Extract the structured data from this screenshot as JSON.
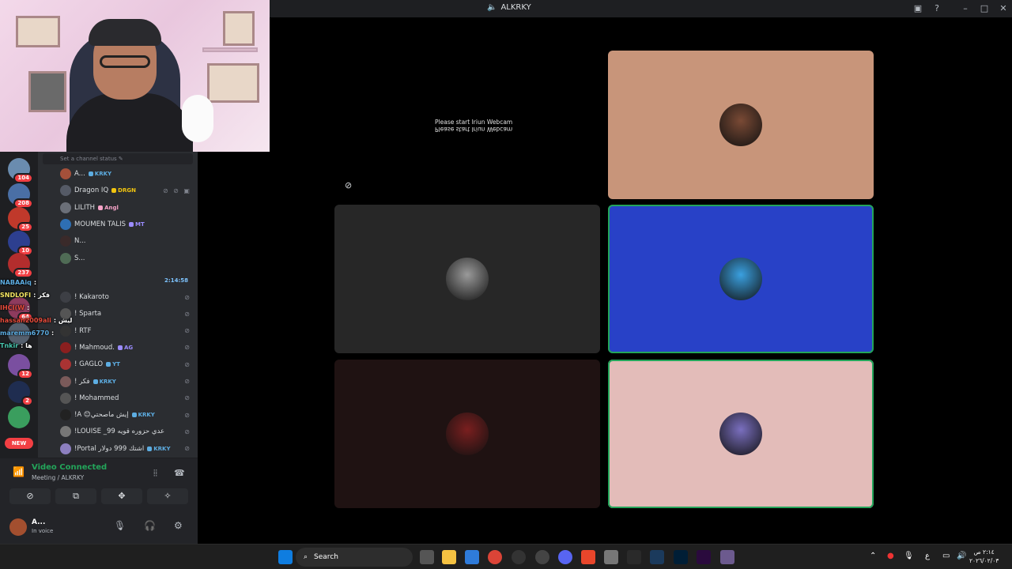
{
  "window": {
    "title": "ALKRKY"
  },
  "channel_status_hint": "Set a channel status",
  "servers": [
    {
      "badge": "104",
      "color": "#6a8caf"
    },
    {
      "badge": "208",
      "color": "#4a6fa5"
    },
    {
      "badge": "25",
      "color": "#c0392b"
    },
    {
      "badge": "10",
      "color": "#2d3f8f"
    },
    {
      "badge": "237",
      "color": "#b32d2d"
    },
    {
      "badge": "64",
      "color": "#8e3b5e"
    },
    {
      "badge": "",
      "color": "#55606e"
    },
    {
      "badge": "12",
      "color": "#7a4fa0"
    },
    {
      "badge": "2",
      "color": "#1f2d50"
    },
    {
      "badge": "",
      "color": "#3a9e5e"
    },
    {
      "badge": "NEW",
      "color": "#f23f43"
    }
  ],
  "members_top": [
    {
      "name": "A...",
      "tag": "KRKY",
      "tag_color": "#5dade2",
      "av": "#a5503a"
    },
    {
      "name": "Dragon IQ",
      "tag": "DRGN",
      "tag_color": "#f1c40f",
      "av": "#555a66",
      "icons": "⊘ ⊘ ▣"
    },
    {
      "name": "LILITH",
      "tag": "Angl",
      "tag_color": "#f5a3c7",
      "av": "#6b6f78"
    },
    {
      "name": "MOUMEN TALIS",
      "tag": "MT",
      "tag_color": "#9b8cff",
      "av": "#2e6fb3"
    },
    {
      "name": "N...",
      "tag": "",
      "tag_color": "#888",
      "av": "#3a2a2a"
    },
    {
      "name": "S...",
      "tag": "",
      "tag_color": "#888",
      "av": "#4f6b55"
    }
  ],
  "members_bottom": [
    {
      "name": "! Kakaroto",
      "tag": "",
      "tag_color": "#5dade2",
      "av": "#3d3f45"
    },
    {
      "name": "! Sparta",
      "tag": "",
      "tag_color": "#bbb",
      "av": "#555"
    },
    {
      "name": "! RTF",
      "tag": "",
      "tag_color": "#bbb",
      "av": "#333"
    },
    {
      "name": "! Mahmoud.",
      "tag": "AG",
      "tag_color": "#9b8cff",
      "av": "#8a1f1f"
    },
    {
      "name": "! GAGLO",
      "tag": "YT",
      "tag_color": "#5dade2",
      "av": "#a33"
    },
    {
      "name": "! فكر",
      "tag": "KRKY",
      "tag_color": "#5dade2",
      "av": "#7a5a5a"
    },
    {
      "name": "! Mohammed",
      "tag": "",
      "tag_color": "#bbb",
      "av": "#555"
    },
    {
      "name": "!A 😊إيش ماصحتي",
      "tag": "KRKY",
      "tag_color": "#5dade2",
      "av": "#222"
    },
    {
      "name": "!LOUISE _99 عدي حزوره قويه",
      "tag": "",
      "tag_color": "#f1c40f",
      "av": "#777"
    },
    {
      "name": "!Portal اشتك 999 دولار",
      "tag": "KRKY",
      "tag_color": "#5dade2",
      "av": "#8c7fbf"
    }
  ],
  "chat": {
    "timestamp": "2:14:58",
    "lines": [
      {
        "user": "NABAAiq",
        "text": ":",
        "color": "#5dade2"
      },
      {
        "user": "SNDLOFI",
        "text": ": فكر",
        "color": "#f5e663"
      },
      {
        "user": "IHCI(W",
        "text": ":",
        "color": "#e74c3c"
      },
      {
        "user": "hassan2009ali",
        "text": ": ليش",
        "color": "#e74c3c"
      },
      {
        "user": "maremm6770",
        "text": ":",
        "color": "#5dade2"
      },
      {
        "user": "Tnkir",
        "text": ": ها",
        "color": "#48c9b0"
      }
    ]
  },
  "voice": {
    "title": "Video Connected",
    "subtitle": "Meeting / ALKRKY",
    "user_name": "A...",
    "user_status": "In voice"
  },
  "stage": {
    "webcam_msg": "Please start Iriun Webcam",
    "tiles": [
      {
        "bg": "#c8957a",
        "av": "#7a4a35",
        "speaking": false
      },
      {
        "bg": "#272727",
        "av": "#9a9a9a",
        "speaking": false
      },
      {
        "bg": "#2841c7",
        "av": "#3aa0e0",
        "speaking": true
      },
      {
        "bg": "#1f1212",
        "av": "#7a1f1f",
        "speaking": false
      },
      {
        "bg": "#e3bcb9",
        "av": "#7a6fbf",
        "speaking": true
      }
    ]
  },
  "taskbar": {
    "search_label": "Search",
    "clock_time": "٢:١٤ ص",
    "clock_date": "٢٠٢٦/٠٢/٠٣",
    "lang": "ع"
  }
}
